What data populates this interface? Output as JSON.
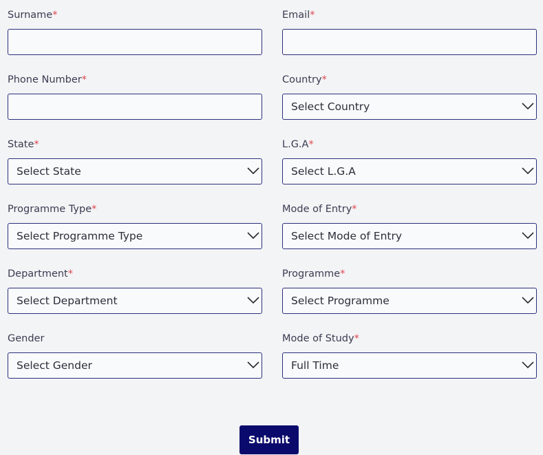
{
  "form": {
    "surname": {
      "label": "Surname",
      "required": "*",
      "value": ""
    },
    "email": {
      "label": "Email",
      "required": "*",
      "value": ""
    },
    "phone": {
      "label": "Phone Number",
      "required": "*",
      "value": ""
    },
    "country": {
      "label": "Country",
      "required": "*",
      "selected": "Select Country"
    },
    "state": {
      "label": "State",
      "required": "*",
      "selected": "Select State"
    },
    "lga": {
      "label": "L.G.A",
      "required": "*",
      "selected": "Select L.G.A"
    },
    "programme_type": {
      "label": "Programme Type",
      "required": "*",
      "selected": "Select Programme Type"
    },
    "mode_of_entry": {
      "label": "Mode of Entry",
      "required": "*",
      "selected": "Select Mode of Entry"
    },
    "department": {
      "label": "Department",
      "required": "*",
      "selected": "Select Department"
    },
    "programme": {
      "label": "Programme",
      "required": "*",
      "selected": "Select Programme"
    },
    "gender": {
      "label": "Gender",
      "selected": "Select Gender"
    },
    "mode_of_study": {
      "label": "Mode of Study",
      "required": "*",
      "selected": "Full Time"
    },
    "submit_label": "Submit"
  },
  "colors": {
    "background": "#f3f4f6",
    "border": "#2a2f7a",
    "required": "#e0454e",
    "button": "#0a0a6c"
  },
  "icons": {
    "select_arrow": "chevron-down-icon"
  }
}
